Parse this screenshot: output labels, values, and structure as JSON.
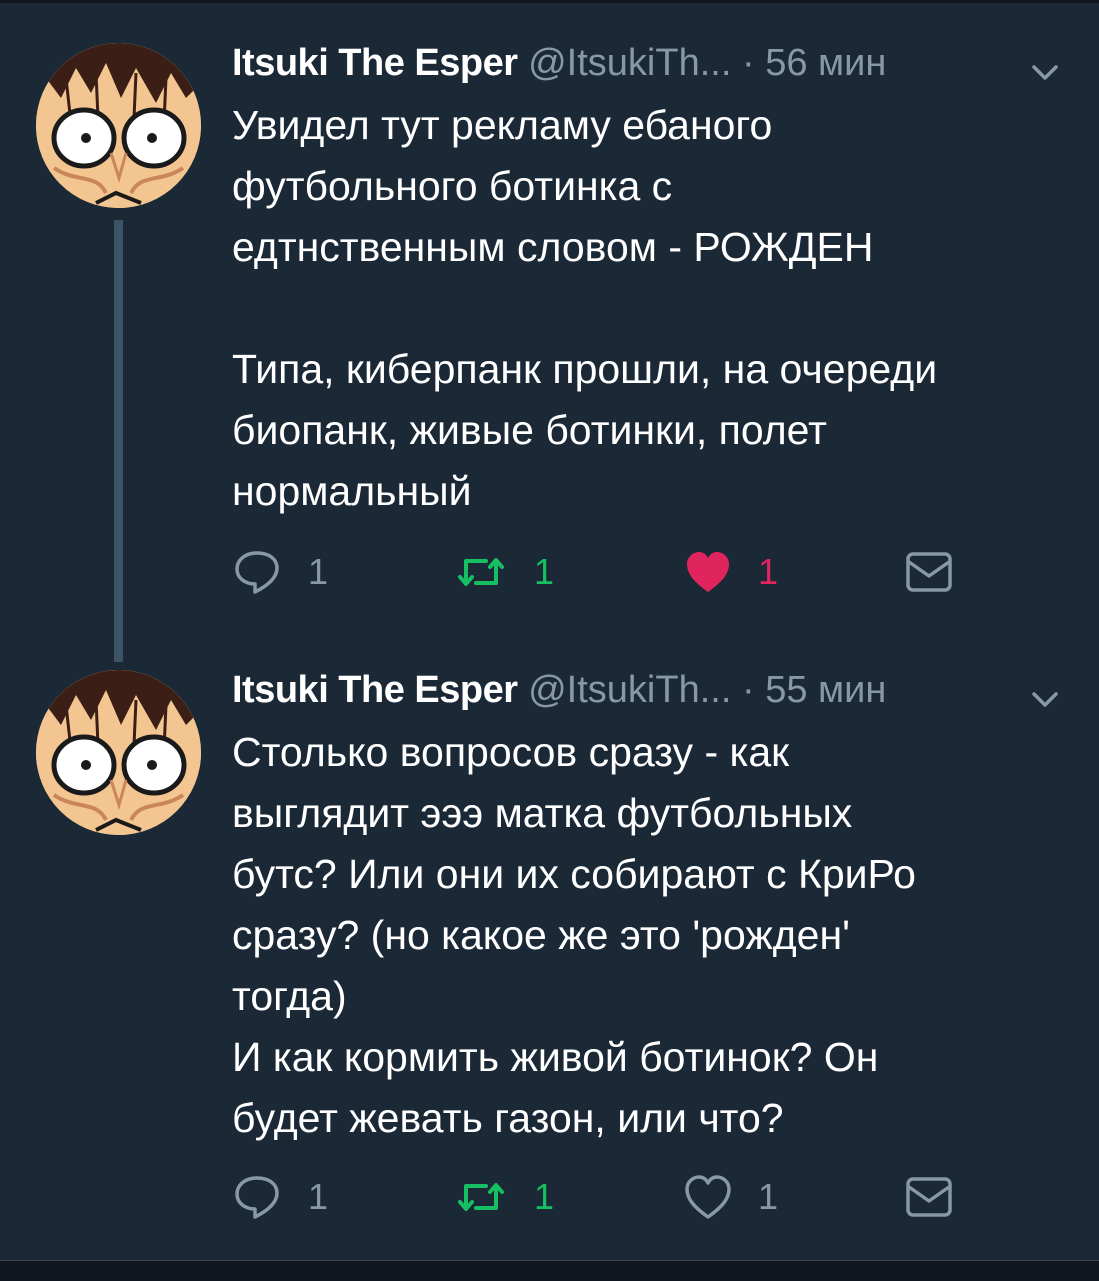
{
  "tweets": [
    {
      "name": "Itsuki The Esper",
      "handle": "@ItsukiTh...",
      "separator": "·",
      "time": "56 мин",
      "text": "Увидел тут рекламу ебаного\nфутбольного ботинка с\nедтнственным словом - РОЖДЕН\n\nТипа, киберпанк прошли, на очереди\nбиопанк, живые ботинки, полет\nнормальный",
      "reply_count": "1",
      "retweet_count": "1",
      "like_count": "1",
      "liked": true,
      "retweeted": true
    },
    {
      "name": "Itsuki The Esper",
      "handle": "@ItsukiTh...",
      "separator": "·",
      "time": "55 мин",
      "text": "Столько вопросов сразу - как\nвыглядит эээ матка футбольных\nбутс? Или они их собирают с КриРо\nсразу? (но какое же это 'рожден'\nтогда)\nИ как кормить живой ботинок? Он\nбудет жевать газон, или что?",
      "reply_count": "1",
      "retweet_count": "1",
      "like_count": "1",
      "liked": false,
      "retweeted": true
    }
  ],
  "colors": {
    "background": "#1b2836",
    "text": "#ffffff",
    "muted": "#8899a6",
    "retweet": "#17bf63",
    "like": "#e0245e",
    "thread_line": "#3d5466"
  },
  "icons": {
    "reply": "reply-icon",
    "retweet": "retweet-icon",
    "like": "heart-icon",
    "message": "envelope-icon",
    "menu": "chevron-down-icon"
  }
}
